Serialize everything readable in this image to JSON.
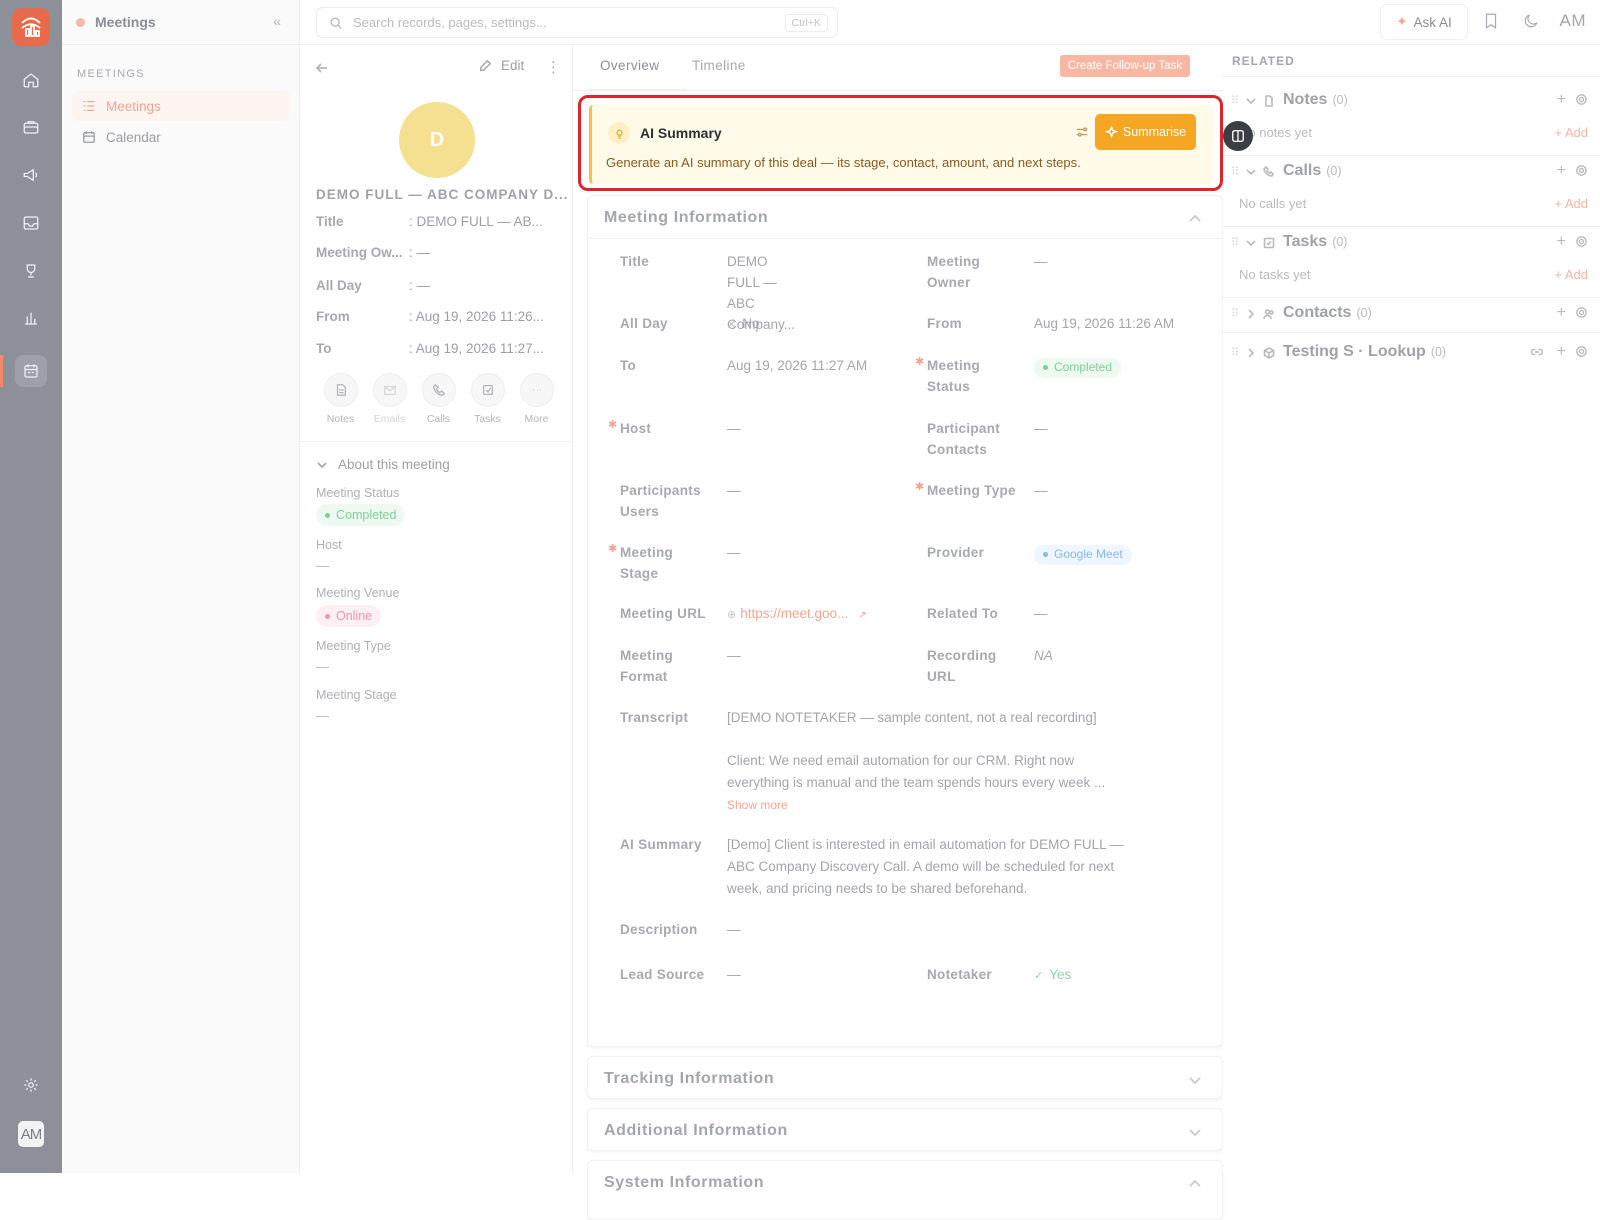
{
  "rail": {
    "items": [
      "home-icon",
      "briefcase-icon",
      "megaphone-icon",
      "inbox-icon",
      "trophy-icon",
      "bar-chart-icon",
      "calendar-icon"
    ],
    "avatar": "AM"
  },
  "nav": {
    "title": "Meetings",
    "section": "MEETINGS",
    "items": [
      {
        "label": "Meetings"
      },
      {
        "label": "Calendar"
      }
    ]
  },
  "topbar": {
    "search_placeholder": "Search records, pages, settings...",
    "shortcut": "Ctrl+K",
    "ask_ai": "Ask AI",
    "user": "AM"
  },
  "record": {
    "initial": "D",
    "name": "DEMO FULL — ABC COMPANY D...",
    "edit": "Edit",
    "summary": [
      {
        "label": "Title",
        "value": ": DEMO FULL — AB..."
      },
      {
        "label": "Meeting Ow...",
        "value": ": —"
      },
      {
        "label": "All Day",
        "value": ": —"
      },
      {
        "label": "From",
        "value": ": Aug 19, 2026 11:26..."
      },
      {
        "label": "To",
        "value": ": Aug 19, 2026 11:27..."
      }
    ],
    "actions": [
      "Notes",
      "Emails",
      "Calls",
      "Tasks",
      "More"
    ],
    "about_title": "About this meeting",
    "about": [
      {
        "label": "Meeting Status",
        "value": "Completed"
      },
      {
        "label": "Host",
        "value": "—"
      },
      {
        "label": "Meeting Venue",
        "value": "Online"
      },
      {
        "label": "Meeting Type",
        "value": "—"
      },
      {
        "label": "Meeting Stage",
        "value": "—"
      }
    ]
  },
  "tabs": {
    "overview": "Overview",
    "timeline": "Timeline",
    "followup": "Create Follow-up Task"
  },
  "ai_summary": {
    "title": "AI Summary",
    "subtitle": "Generate an AI summary of this deal — its stage, contact, amount, and next steps.",
    "button": "Summarise"
  },
  "meeting_info": {
    "header": "Meeting Information",
    "fields": {
      "title_l": "Title",
      "title_v1": "DEMO FULL — ABC",
      "title_v2": "Company...",
      "owner_l1": "Meeting",
      "owner_l2": "Owner",
      "owner_v": "—",
      "allday_l": "All Day",
      "allday_v": "No",
      "from_l": "From",
      "from_v": "Aug 19, 2026 11:26 AM",
      "to_l": "To",
      "to_v": "Aug 19, 2026 11:27 AM",
      "status_l1": "Meeting",
      "status_l2": "Status",
      "status_v": "Completed",
      "host_l": "Host",
      "host_v": "—",
      "pc_l1": "Participant",
      "pc_l2": "Contacts",
      "pc_v": "—",
      "pu_l1": "Participants",
      "pu_l2": "Users",
      "pu_v": "—",
      "type_l": "Meeting Type",
      "type_v": "—",
      "stage_l1": "Meeting",
      "stage_l2": "Stage",
      "stage_v": "—",
      "provider_l": "Provider",
      "provider_v": "Google Meet",
      "url_l": "Meeting URL",
      "url_v": "https://meet.goo...",
      "related_l": "Related To",
      "related_v": "—",
      "format_l1": "Meeting",
      "format_l2": "Format",
      "format_v": "—",
      "rec_l1": "Recording",
      "rec_l2": "URL",
      "rec_v": "NA",
      "transcript_l": "Transcript",
      "transcript_v1": "[DEMO NOTETAKER — sample content, not a real recording]",
      "transcript_v2": "Client: We need email automation for our CRM. Right now",
      "transcript_v3": "everything is manual and the team spends hours every week ...",
      "show_more": "Show more",
      "ai_l": "AI Summary",
      "ai_v1": "[Demo] Client is interested in email automation for DEMO FULL —",
      "ai_v2": "ABC Company Discovery Call. A demo will be scheduled for next",
      "ai_v3": "week, and pricing needs to be shared beforehand.",
      "desc_l": "Description",
      "desc_v": "—",
      "lead_l": "Lead Source",
      "lead_v": "—",
      "notetaker_l": "Notetaker",
      "notetaker_v": "Yes"
    }
  },
  "sections": {
    "tracking": "Tracking Information",
    "additional": "Additional Information",
    "system": "System Information"
  },
  "related": {
    "header": "RELATED",
    "items": [
      {
        "name": "Notes",
        "count": "(0)",
        "empty": "No notes yet",
        "add": "+ Add"
      },
      {
        "name": "Calls",
        "count": "(0)",
        "empty": "No calls yet",
        "add": "+ Add"
      },
      {
        "name": "Tasks",
        "count": "(0)",
        "empty": "No tasks yet",
        "add": "+ Add"
      },
      {
        "name": "Contacts",
        "count": "(0)"
      },
      {
        "name": "Testing S · Lookup",
        "count": "(0)"
      }
    ]
  }
}
